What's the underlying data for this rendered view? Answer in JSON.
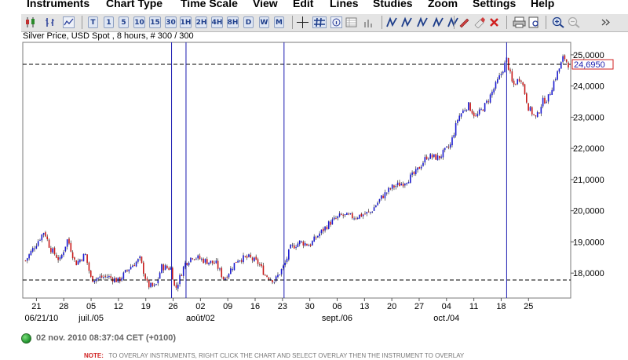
{
  "menu": [
    "Instruments",
    "Chart Type",
    "Time Scale",
    "View",
    "Edit",
    "Lines",
    "Studies",
    "Zoom",
    "Settings",
    "Help"
  ],
  "toolbar": {
    "time_buttons": [
      "T",
      "1",
      "5",
      "10",
      "15",
      "30",
      "1H",
      "2H",
      "4H",
      "8H",
      "D",
      "W",
      "M"
    ]
  },
  "chart_title": "Silver Price, USD Spot , 8 hours, # 300 / 300",
  "status": {
    "time": "02 nov. 2010 08:37:04  CET (+0100)",
    "dot_color": "#1c8f2a"
  },
  "note": {
    "label": "NOTE:",
    "text": "TO OVERLAY INSTRUMENTS, RIGHT CLICK THE CHART AND SELECT OVERLAY THEN THE INSTRUMENT TO OVERLAY"
  },
  "chart_data": {
    "type": "candlestick",
    "title": "Silver Price, USD Spot , 8 hours, # 300 / 300",
    "ylim": [
      17.2,
      25.4
    ],
    "y_ticks": [
      "25,0000",
      "24,0000",
      "23,0000",
      "22,0000",
      "21,0000",
      "20,0000",
      "19,0000",
      "18,0000"
    ],
    "y_tick_values": [
      25,
      24,
      23,
      22,
      21,
      20,
      19,
      18
    ],
    "current_price_label": "24,6950",
    "current_price": 24.695,
    "support_level": 17.78,
    "x_tick_labels": [
      "21",
      "28",
      "05",
      "12",
      "19",
      "26",
      "02",
      "09",
      "16",
      "23",
      "30",
      "06",
      "13",
      "20",
      "27",
      "04",
      "11",
      "18",
      "25"
    ],
    "x_tick_days": [
      1,
      8,
      15,
      22,
      29,
      36,
      43,
      50,
      57,
      64,
      71,
      78,
      85,
      92,
      99,
      106,
      113,
      120,
      127
    ],
    "period_labels": [
      "06/21/10",
      "juil./05",
      "août/02",
      "sept./06",
      "oct./04"
    ],
    "period_label_days": [
      -2,
      15,
      43,
      78,
      106
    ],
    "vertical_marker_days": [
      35.6,
      39.3,
      64.4,
      121.4
    ],
    "x_day_range": [
      -2.5,
      137.8
    ],
    "series": [
      {
        "day": -1.8,
        "close": 18.4
      },
      {
        "day": 3.0,
        "close": 19.35
      },
      {
        "day": 4.5,
        "close": 18.8
      },
      {
        "day": 7.0,
        "close": 18.4
      },
      {
        "day": 9.0,
        "close": 19.1
      },
      {
        "day": 11.0,
        "close": 18.3
      },
      {
        "day": 13.5,
        "close": 18.6
      },
      {
        "day": 15.0,
        "close": 17.8
      },
      {
        "day": 19.0,
        "close": 17.9
      },
      {
        "day": 22.0,
        "close": 17.75
      },
      {
        "day": 25.0,
        "close": 18.2
      },
      {
        "day": 27.5,
        "close": 18.45
      },
      {
        "day": 29.5,
        "close": 17.6
      },
      {
        "day": 31.5,
        "close": 17.55
      },
      {
        "day": 33.0,
        "close": 18.2
      },
      {
        "day": 35.5,
        "close": 18.15
      },
      {
        "day": 36.5,
        "close": 17.45
      },
      {
        "day": 39.0,
        "close": 18.3
      },
      {
        "day": 41.0,
        "close": 18.55
      },
      {
        "day": 44.0,
        "close": 18.4
      },
      {
        "day": 47.0,
        "close": 18.3
      },
      {
        "day": 49.0,
        "close": 17.8
      },
      {
        "day": 52.5,
        "close": 18.45
      },
      {
        "day": 55.5,
        "close": 18.5
      },
      {
        "day": 58.0,
        "close": 18.3
      },
      {
        "day": 59.5,
        "close": 17.95
      },
      {
        "day": 62.0,
        "close": 17.75
      },
      {
        "day": 64.5,
        "close": 18.25
      },
      {
        "day": 66.0,
        "close": 18.8
      },
      {
        "day": 68.5,
        "close": 19.0
      },
      {
        "day": 71.0,
        "close": 18.9
      },
      {
        "day": 73.0,
        "close": 19.2
      },
      {
        "day": 76.0,
        "close": 19.6
      },
      {
        "day": 79.0,
        "close": 19.85
      },
      {
        "day": 82.5,
        "close": 19.8
      },
      {
        "day": 86.5,
        "close": 19.95
      },
      {
        "day": 89.5,
        "close": 20.45
      },
      {
        "day": 92.0,
        "close": 20.75
      },
      {
        "day": 95.0,
        "close": 20.9
      },
      {
        "day": 98.0,
        "close": 21.2
      },
      {
        "day": 101.0,
        "close": 21.75
      },
      {
        "day": 104.0,
        "close": 21.7
      },
      {
        "day": 107.0,
        "close": 22.1
      },
      {
        "day": 109.0,
        "close": 23.0
      },
      {
        "day": 111.5,
        "close": 23.4
      },
      {
        "day": 113.5,
        "close": 23.0
      },
      {
        "day": 116.0,
        "close": 23.4
      },
      {
        "day": 118.5,
        "close": 24.0
      },
      {
        "day": 120.0,
        "close": 24.4
      },
      {
        "day": 121.4,
        "close": 24.85
      },
      {
        "day": 123.0,
        "close": 24.0
      },
      {
        "day": 125.0,
        "close": 24.3
      },
      {
        "day": 127.0,
        "close": 23.3
      },
      {
        "day": 129.0,
        "close": 22.95
      },
      {
        "day": 130.5,
        "close": 23.5
      },
      {
        "day": 132.0,
        "close": 23.6
      },
      {
        "day": 133.5,
        "close": 24.15
      },
      {
        "day": 135.0,
        "close": 24.6
      },
      {
        "day": 136.0,
        "close": 24.95
      },
      {
        "day": 137.2,
        "close": 24.7
      }
    ]
  }
}
